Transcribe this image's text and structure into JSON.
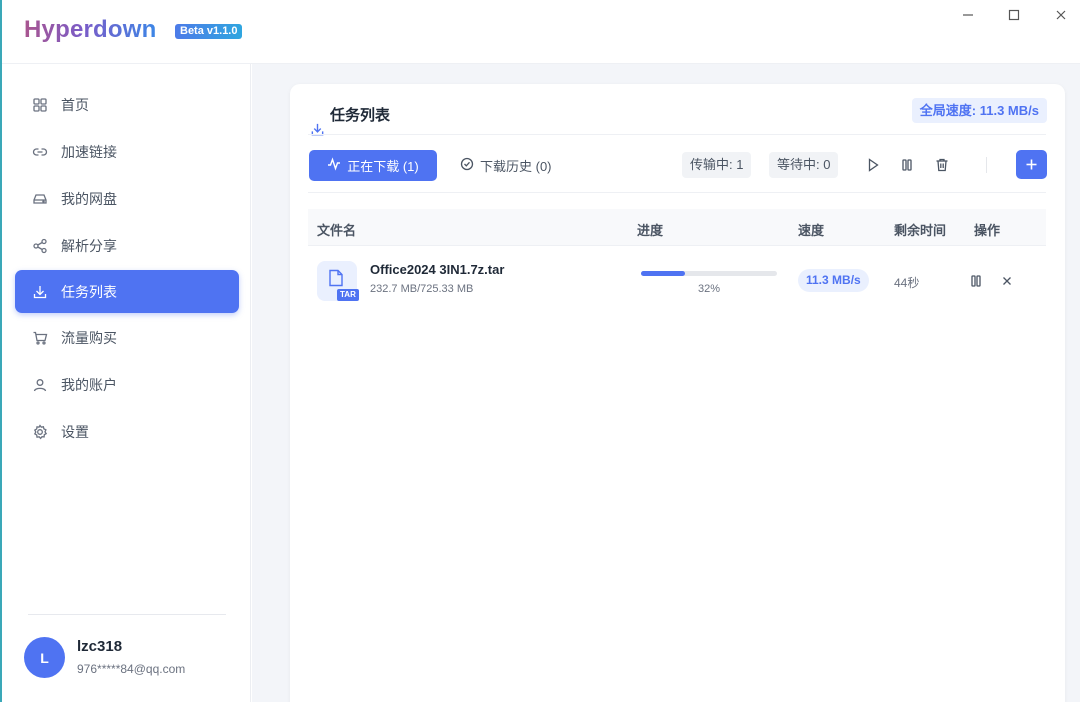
{
  "app": {
    "brand": "Hyperdown",
    "version_badge": "Beta v1.1.0"
  },
  "window_controls": [
    "minimize-icon",
    "maximize-icon",
    "close-icon"
  ],
  "sidebar": {
    "items": [
      {
        "label": "首页",
        "icon": "grid-icon"
      },
      {
        "label": "加速链接",
        "icon": "link-icon"
      },
      {
        "label": "我的网盘",
        "icon": "drive-icon"
      },
      {
        "label": "解析分享",
        "icon": "share-icon"
      },
      {
        "label": "任务列表",
        "icon": "download-icon",
        "active": true
      },
      {
        "label": "流量购买",
        "icon": "cart-icon"
      },
      {
        "label": "我的账户",
        "icon": "user-icon"
      },
      {
        "label": "设置",
        "icon": "gear-icon"
      }
    ],
    "user": {
      "avatar_letter": "L",
      "name": "lzc318",
      "email": "976*****84@qq.com"
    }
  },
  "main": {
    "title": "任务列表",
    "global_speed": "全局速度: 11.3 MB/s",
    "tabs": {
      "downloading": "正在下载 (1)",
      "history": "下载历史 (0)"
    },
    "stats": {
      "transferring": "传输中: 1",
      "waiting": "等待中: 0"
    },
    "table": {
      "headers": [
        "文件名",
        "进度",
        "速度",
        "剩余时间",
        "操作"
      ],
      "rows": [
        {
          "file_name": "Office2024 3IN1.7z.tar",
          "file_type": "TAR",
          "size": "232.7 MB/725.33 MB",
          "progress_pct": 32,
          "progress_text": "32%",
          "speed": "11.3 MB/s",
          "remaining": "44秒"
        }
      ]
    }
  },
  "colors": {
    "accent": "#4f73f2",
    "accent_light": "#eaf0fe",
    "background": "#f3f5f9"
  }
}
